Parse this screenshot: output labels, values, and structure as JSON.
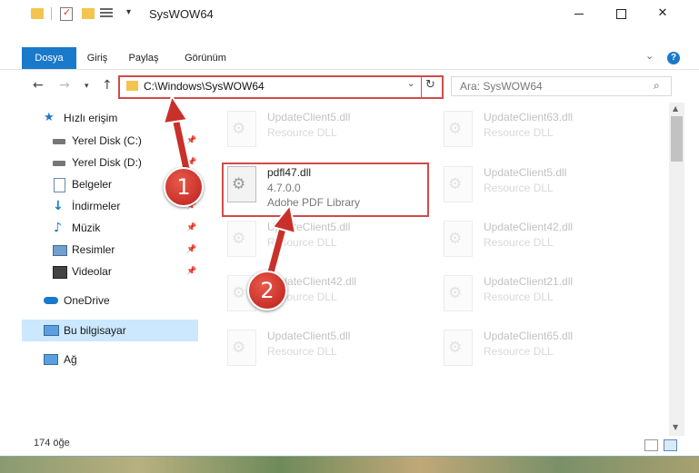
{
  "window": {
    "title": "SysWOW64"
  },
  "ribbon": {
    "tabs": [
      "Dosya",
      "Giriş",
      "Paylaş",
      "Görünüm"
    ]
  },
  "address": {
    "path": "C:\\Windows\\SysWOW64"
  },
  "search": {
    "placeholder": "Ara: SysWOW64"
  },
  "sidebar": {
    "items": [
      {
        "label": "Hızlı erişim",
        "icon": "star-icon"
      },
      {
        "label": "Yerel Disk (C:)",
        "icon": "drive-icon",
        "pinned": true
      },
      {
        "label": "Yerel Disk (D:)",
        "icon": "drive-icon",
        "pinned": true
      },
      {
        "label": "Belgeler",
        "icon": "document-icon",
        "pinned": true
      },
      {
        "label": "İndirmeler",
        "icon": "download-icon",
        "pinned": true
      },
      {
        "label": "Müzik",
        "icon": "music-icon",
        "pinned": true
      },
      {
        "label": "Resimler",
        "icon": "picture-icon",
        "pinned": true
      },
      {
        "label": "Videolar",
        "icon": "video-icon",
        "pinned": true
      },
      {
        "label": "OneDrive",
        "icon": "cloud-icon"
      },
      {
        "label": "Bu bilgisayar",
        "icon": "computer-icon",
        "selected": true
      },
      {
        "label": "Ağ",
        "icon": "network-icon"
      }
    ]
  },
  "files": [
    {
      "name": "UpdateClient5.dll",
      "desc": "Resource DLL"
    },
    {
      "name": "UpdateClient63.dll",
      "desc": "Resource DLL"
    },
    {
      "name": "pdfl47.dll",
      "version": "4.7.0.0",
      "desc": "Adobe PDF Library"
    },
    {
      "name": "UpdateClient5.dll",
      "desc": "Resource DLL"
    },
    {
      "name": "UpdateClient5.dll",
      "desc": "Resource DLL"
    },
    {
      "name": "UpdateClient42.dll",
      "desc": "Resource DLL"
    },
    {
      "name": "UpdateClient42.dll",
      "desc": "Resource DLL"
    },
    {
      "name": "UpdateClient21.dll",
      "desc": "Resource DLL"
    },
    {
      "name": "UpdateClient5.dll",
      "desc": "Resource DLL"
    },
    {
      "name": "UpdateClient65.dll",
      "desc": "Resource DLL"
    }
  ],
  "status": {
    "count": "174 öğe"
  },
  "annotations": {
    "step1": "1",
    "step2": "2",
    "color": "#d24a4a"
  }
}
